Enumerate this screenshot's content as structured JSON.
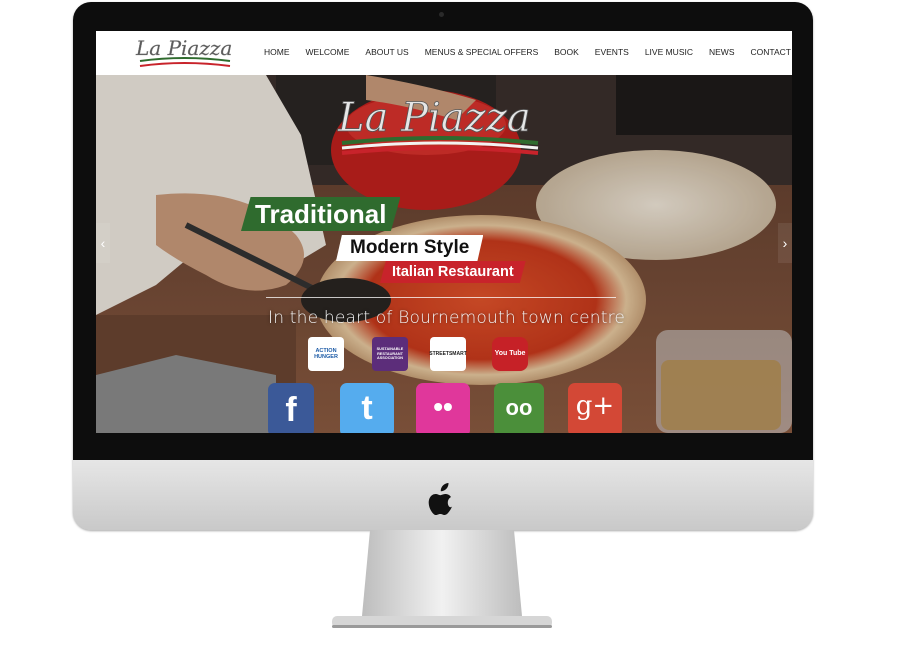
{
  "site": {
    "logo_text": "La Piazza",
    "nav": [
      "HOME",
      "WELCOME",
      "ABOUT US",
      "MENUS & SPECIAL OFFERS",
      "BOOK",
      "EVENTS",
      "LIVE MUSIC",
      "NEWS",
      "CONTACT"
    ]
  },
  "hero": {
    "logo_text": "La Piazza",
    "line1": "Traditional",
    "line2": "Modern Style",
    "line3": "Italian Restaurant",
    "subtitle": "In the heart of Bournemouth town centre",
    "prev_arrow": "‹",
    "next_arrow": "›"
  },
  "badges": [
    {
      "name": "action-against-hunger",
      "text": "ACTION HUNGER"
    },
    {
      "name": "sustainable-restaurant-association",
      "text": "SUSTAINABLE RESTAURANT ASSOCIATION"
    },
    {
      "name": "streetsmart",
      "text": "STREETSMART"
    },
    {
      "name": "youtube",
      "text": "You Tube"
    }
  ],
  "social": [
    {
      "name": "facebook",
      "glyph": "f",
      "color": "#3b5998"
    },
    {
      "name": "twitter",
      "glyph": "t",
      "color": "#55acee"
    },
    {
      "name": "flickr",
      "glyph": "••",
      "color": "#e0379b"
    },
    {
      "name": "tripadvisor",
      "glyph": "oo",
      "color": "#4b8f3a"
    },
    {
      "name": "google-plus",
      "glyph": "g+",
      "color": "#d34836"
    }
  ],
  "colors": {
    "green": "#2f6b2e",
    "red": "#c8232b",
    "white": "#ffffff"
  }
}
